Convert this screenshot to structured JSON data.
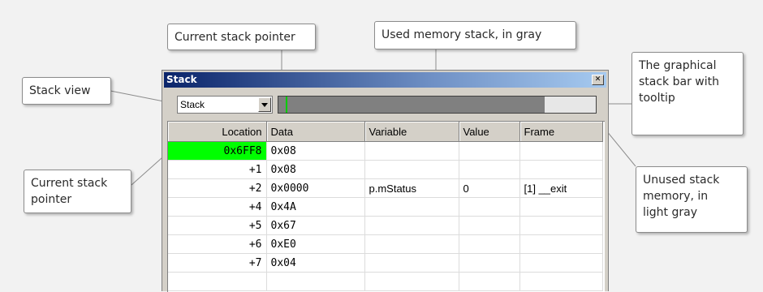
{
  "callouts": {
    "current_sp_top": "Current stack pointer",
    "used_memory": "Used memory stack, in gray",
    "stack_view": "Stack view",
    "graphical_bar": "The graphical\nstack bar with\ntooltip",
    "current_sp_left": "Current stack\npointer",
    "unused_memory": "Unused stack\nmemory, in\nlight gray"
  },
  "window": {
    "title": "Stack",
    "close_glyph": "✕",
    "combo_value": "Stack",
    "stack_bar": {
      "used_fraction": 0.84
    }
  },
  "colors": {
    "current_sp": "#00ff00",
    "used_memory": "#808080",
    "unused_memory": "#e7e7e7"
  },
  "table": {
    "columns": [
      "Location",
      "Data",
      "Variable",
      "Value",
      "Frame"
    ],
    "rows": [
      {
        "location": "0x6FF8",
        "data": "0x08",
        "variable": "",
        "value": "",
        "frame": "",
        "current": true
      },
      {
        "location": "+1",
        "data": "0x08",
        "variable": "",
        "value": "",
        "frame": ""
      },
      {
        "location": "+2",
        "data": "0x0000",
        "variable": "p.mStatus",
        "value": "0",
        "frame": "[1] __exit"
      },
      {
        "location": "+4",
        "data": "0x4A",
        "variable": "",
        "value": "",
        "frame": ""
      },
      {
        "location": "+5",
        "data": "0x67",
        "variable": "",
        "value": "",
        "frame": ""
      },
      {
        "location": "+6",
        "data": "0xE0",
        "variable": "",
        "value": "",
        "frame": ""
      },
      {
        "location": "+7",
        "data": "0x04",
        "variable": "",
        "value": "",
        "frame": ""
      },
      {
        "location": "",
        "data": "",
        "variable": "",
        "value": "",
        "frame": ""
      }
    ]
  }
}
